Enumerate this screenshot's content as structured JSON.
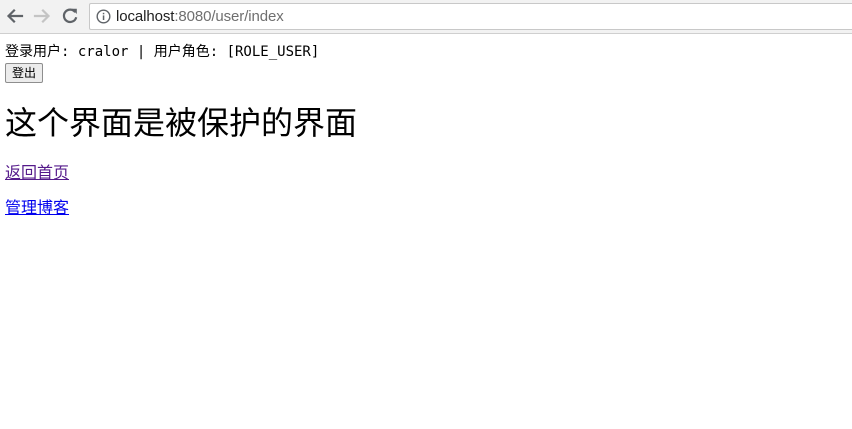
{
  "browser": {
    "url_host": "localhost",
    "url_rest": ":8080/user/index",
    "back_icon": "back-arrow-icon",
    "forward_icon": "forward-arrow-icon",
    "reload_icon": "reload-icon",
    "info_icon": "info-circle-icon"
  },
  "page": {
    "login_line": "登录用户: cralor | 用户角色: [ROLE_USER]",
    "logout_label": "登出",
    "heading": "这个界面是被保护的界面",
    "links": {
      "home": "返回首页",
      "manage_blog": "管理博客"
    }
  },
  "colors": {
    "visited_link": "#551a8b",
    "link": "#0000ee",
    "toolbar_bg": "#f2f2f2"
  }
}
